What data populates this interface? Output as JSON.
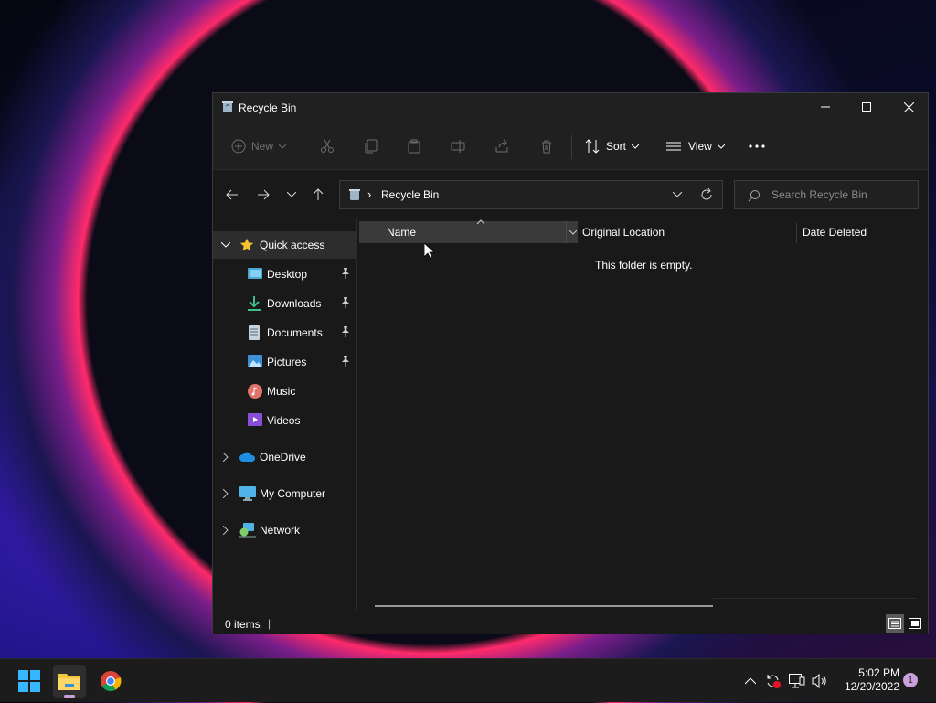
{
  "window": {
    "title": "Recycle Bin"
  },
  "toolbar": {
    "new_label": "New",
    "sort_label": "Sort",
    "view_label": "View",
    "icons": [
      "new-icon",
      "cut-icon",
      "copy-icon",
      "paste-icon",
      "rename-icon",
      "share-icon",
      "delete-icon",
      "sort-icon",
      "view-icon",
      "more-icon"
    ]
  },
  "address": {
    "path_separator": "›",
    "location": "Recycle Bin"
  },
  "search": {
    "placeholder": "Search Recycle Bin"
  },
  "sidebar": {
    "quick_access": "Quick access",
    "items": [
      {
        "label": "Desktop",
        "icon": "desktop-icon",
        "pinned": true
      },
      {
        "label": "Downloads",
        "icon": "downloads-icon",
        "pinned": true
      },
      {
        "label": "Documents",
        "icon": "documents-icon",
        "pinned": true
      },
      {
        "label": "Pictures",
        "icon": "pictures-icon",
        "pinned": true
      },
      {
        "label": "Music",
        "icon": "music-icon",
        "pinned": false
      },
      {
        "label": "Videos",
        "icon": "videos-icon",
        "pinned": false
      }
    ],
    "roots": [
      {
        "label": "OneDrive",
        "icon": "onedrive-icon"
      },
      {
        "label": "My Computer",
        "icon": "computer-icon"
      },
      {
        "label": "Network",
        "icon": "network-icon"
      }
    ]
  },
  "columns": {
    "name": "Name",
    "original_location": "Original Location",
    "date_deleted": "Date Deleted"
  },
  "content": {
    "empty_message": "This folder is empty."
  },
  "status": {
    "item_count": "0 items",
    "separator": "|"
  },
  "taskbar": {
    "time": "5:02 PM",
    "date": "12/20/2022",
    "notification_count": "1"
  },
  "colors": {
    "accent": "#4cc2ff",
    "window_bg": "#191919",
    "titlebar_bg": "#202020",
    "notification_badge": "#c9a0dc"
  }
}
